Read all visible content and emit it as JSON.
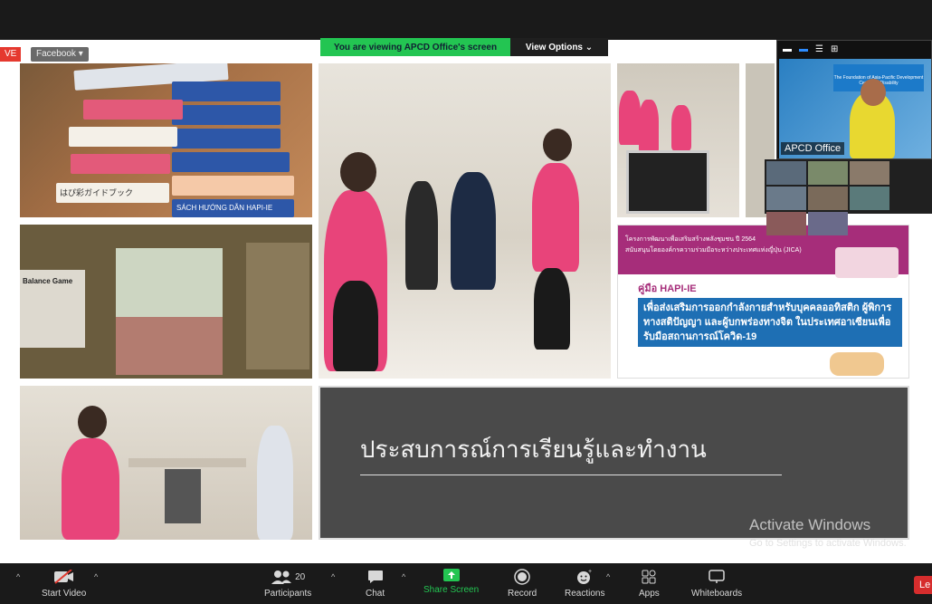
{
  "top": {
    "live_badge": "VE",
    "facebook_button": "Facebook ▾",
    "viewing_banner": "You are viewing APCD Office's screen",
    "view_options": "View Options ⌄"
  },
  "slides": {
    "main_title": "ประสบการณ์การเรียนรู้และทำงาน",
    "balance_game": "Balance Game",
    "hapi_label": "คู่มือ HAPI-IE",
    "hapi_body": "เพื่อส่งเสริมการออกกำลังกายสำหรับบุคคลออทิสติก ผู้พิการทางสติปัญญา และผู้บกพร่องทางจิต ในประเทศอาเซียนเพื่อรับมือสถานการณ์โควิด-19",
    "banner_top_line1": "โครงการพัฒนาเพื่อเสริมสร้างพลังชุมชน ปี 2564",
    "banner_top_line2": "สนับสนุนโดยองค์กรความร่วมมือระหว่างประเทศแห่งญี่ปุ่น (JICA)",
    "booklet_title": "はぴ彩ガイドブック",
    "booklet_vn": "SÁCH HƯỚNG DẪN HAPI-IE"
  },
  "video_tile": {
    "speaker_label": "APCD Office",
    "logo_text": "The Foundation of Asia-Pacific Development Center on Disability"
  },
  "watermark": {
    "title": "Activate Windows",
    "subtitle": "Go to Settings to activate Windows."
  },
  "toolbar": {
    "start_video": "Start Video",
    "participants": "Participants",
    "participants_count": "20",
    "chat": "Chat",
    "share_screen": "Share Screen",
    "record": "Record",
    "reactions": "Reactions",
    "apps": "Apps",
    "whiteboards": "Whiteboards",
    "leave": "Le"
  },
  "colors": {
    "zoom_green": "#23c552",
    "leave_red": "#d62d2d",
    "hapi_magenta": "#a62d7a",
    "hapi_blue": "#1e6fb4"
  }
}
